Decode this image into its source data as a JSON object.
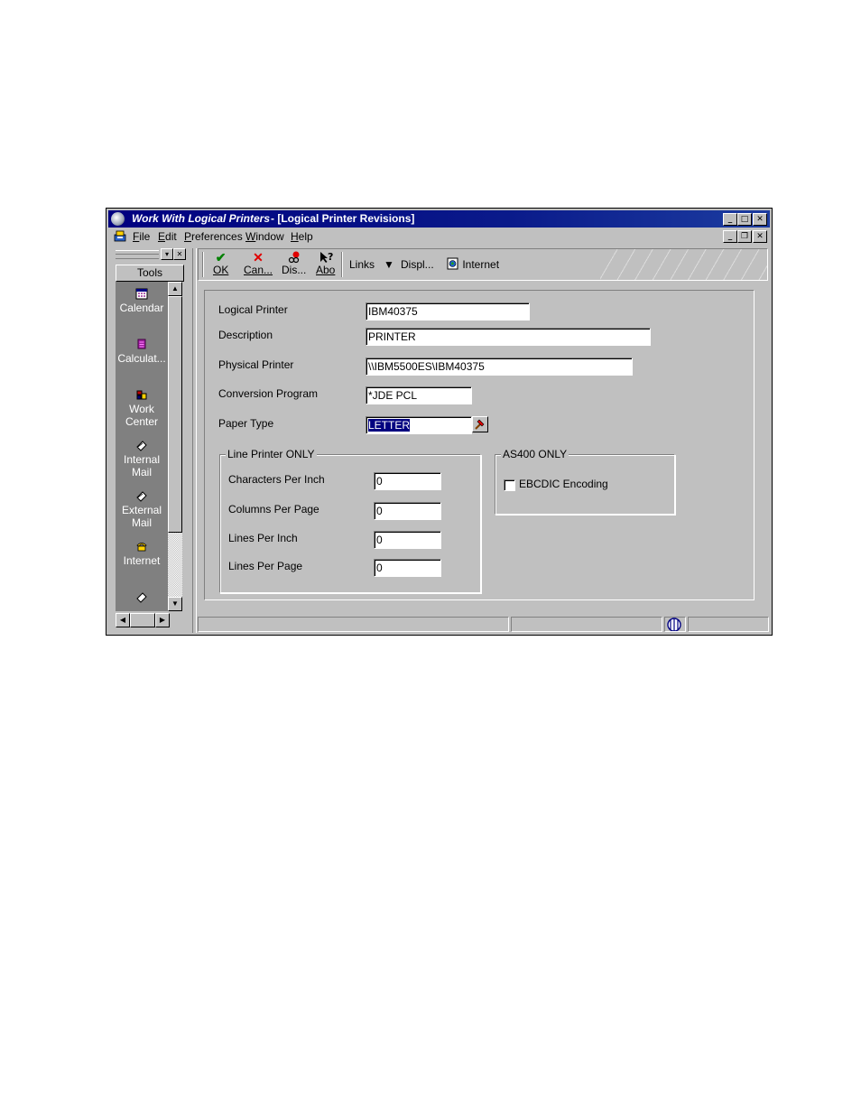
{
  "window": {
    "app_title": "Work With Logical Printers",
    "doc_title": " - [Logical Printer Revisions]",
    "controls": [
      "minimize",
      "maximize",
      "close"
    ]
  },
  "menu": {
    "items": [
      "File",
      "Edit",
      "Preferences",
      "Window",
      "Help"
    ]
  },
  "tools": {
    "header": "Tools",
    "items": [
      {
        "label": "Calendar",
        "icon": "calendar-icon"
      },
      {
        "label": "Calculat...",
        "icon": "calculator-icon"
      },
      {
        "label": "Work Center",
        "icon": "work-center-icon"
      },
      {
        "label": "Internal Mail",
        "icon": "internal-mail-icon"
      },
      {
        "label": "External Mail",
        "icon": "external-mail-icon"
      },
      {
        "label": "Internet",
        "icon": "phone-icon"
      }
    ]
  },
  "toolbar": {
    "ok": "OK",
    "cancel": "Can...",
    "display": "Dis...",
    "about": "Abo",
    "links": "Links",
    "displ": "Displ...",
    "internet": "Internet"
  },
  "form": {
    "logical_printer_label": "Logical Printer",
    "logical_printer_value": "IBM40375",
    "description_label": "Description",
    "description_value": "PRINTER",
    "physical_printer_label": "Physical Printer",
    "physical_printer_value": "\\\\IBM5500ES\\IBM40375",
    "conversion_program_label": "Conversion Program",
    "conversion_program_value": "*JDE PCL",
    "paper_type_label": "Paper Type",
    "paper_type_value": "LETTER",
    "line_printer_group": "Line Printer ONLY",
    "cpi_label": "Characters Per Inch",
    "cpi_value": "0",
    "cpp_label": "Columns Per Page",
    "cpp_value": "0",
    "lpi_label": "Lines Per Inch",
    "lpi_value": "0",
    "lpp_label": "Lines Per Page",
    "lpp_value": "0",
    "as400_group": "AS400 ONLY",
    "ebcdic_label": "EBCDIC Encoding",
    "ebcdic_checked": false
  },
  "colors": {
    "titlebar": "#000080",
    "face": "#c0c0c0",
    "tools_bg": "#808080"
  }
}
